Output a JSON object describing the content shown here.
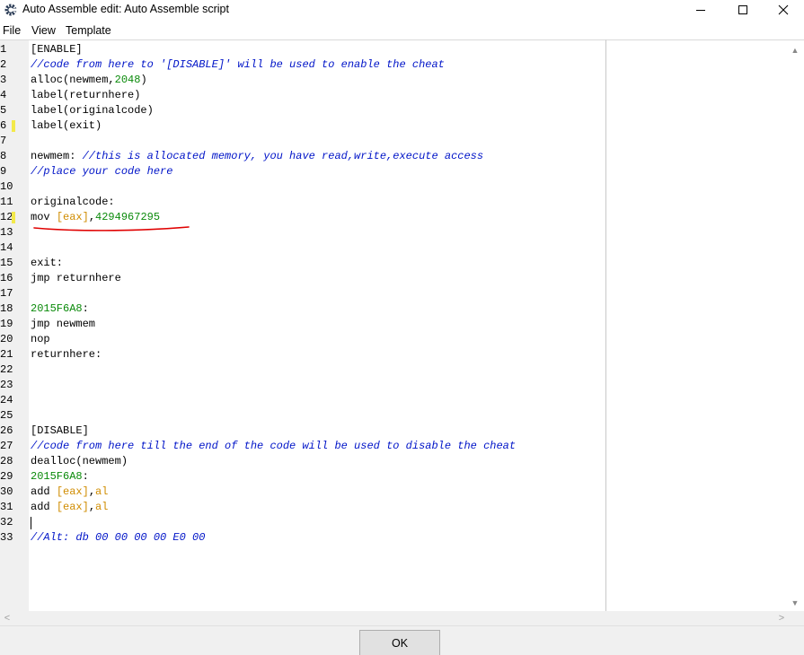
{
  "window": {
    "title": "Auto Assemble edit: Auto Assemble script",
    "minimize_symbol": "—",
    "maximize_symbol": "☐",
    "close_symbol": "✕",
    "icon": "cheat-engine-gear-icon"
  },
  "menu": {
    "items": [
      {
        "label": "File"
      },
      {
        "label": "View"
      },
      {
        "label": "Template"
      }
    ]
  },
  "colors": {
    "comment": "#0014c8",
    "number": "#0a8a0a",
    "register": "#d08c00",
    "gutter_mark": "#f3e94a",
    "annotation_underline": "#e00000"
  },
  "editor": {
    "marked_lines": [
      6,
      12
    ],
    "caret_line": 32,
    "lines": [
      {
        "n": "1",
        "parts": [
          {
            "t": "[ENABLE]",
            "c": "kw"
          }
        ]
      },
      {
        "n": "2",
        "parts": [
          {
            "t": "//code from here to '[DISABLE]' will be used to enable the cheat",
            "c": "cm"
          }
        ]
      },
      {
        "n": "3",
        "parts": [
          {
            "t": "alloc(newmem,",
            "c": "kw"
          },
          {
            "t": "2048",
            "c": "nm"
          },
          {
            "t": ")",
            "c": "kw"
          }
        ]
      },
      {
        "n": "4",
        "parts": [
          {
            "t": "label(returnhere)",
            "c": "kw"
          }
        ]
      },
      {
        "n": "5",
        "parts": [
          {
            "t": "label(originalcode)",
            "c": "kw"
          }
        ]
      },
      {
        "n": "6",
        "parts": [
          {
            "t": "label(exit)",
            "c": "kw"
          }
        ]
      },
      {
        "n": "7",
        "parts": []
      },
      {
        "n": "8",
        "parts": [
          {
            "t": "newmem: ",
            "c": "kw"
          },
          {
            "t": "//this is allocated memory, you have read,write,execute access",
            "c": "cm"
          }
        ]
      },
      {
        "n": "9",
        "parts": [
          {
            "t": "//place your code here",
            "c": "cm"
          }
        ]
      },
      {
        "n": "10",
        "parts": []
      },
      {
        "n": "11",
        "parts": [
          {
            "t": "originalcode:",
            "c": "kw"
          }
        ]
      },
      {
        "n": "12",
        "parts": [
          {
            "t": "mov ",
            "c": "kw"
          },
          {
            "t": "[eax]",
            "c": "rg"
          },
          {
            "t": ",",
            "c": "kw"
          },
          {
            "t": "4294967295",
            "c": "nm"
          }
        ]
      },
      {
        "n": "13",
        "parts": []
      },
      {
        "n": "14",
        "parts": []
      },
      {
        "n": "15",
        "parts": [
          {
            "t": "exit:",
            "c": "kw"
          }
        ]
      },
      {
        "n": "16",
        "parts": [
          {
            "t": "jmp returnhere",
            "c": "kw"
          }
        ]
      },
      {
        "n": "17",
        "parts": []
      },
      {
        "n": "18",
        "parts": [
          {
            "t": "2015F6A8",
            "c": "nm"
          },
          {
            "t": ":",
            "c": "kw"
          }
        ]
      },
      {
        "n": "19",
        "parts": [
          {
            "t": "jmp newmem",
            "c": "kw"
          }
        ]
      },
      {
        "n": "20",
        "parts": [
          {
            "t": "nop",
            "c": "kw"
          }
        ]
      },
      {
        "n": "21",
        "parts": [
          {
            "t": "returnhere:",
            "c": "kw"
          }
        ]
      },
      {
        "n": "22",
        "parts": []
      },
      {
        "n": "23",
        "parts": []
      },
      {
        "n": "24",
        "parts": []
      },
      {
        "n": "25",
        "parts": []
      },
      {
        "n": "26",
        "parts": [
          {
            "t": "[DISABLE]",
            "c": "kw"
          }
        ]
      },
      {
        "n": "27",
        "parts": [
          {
            "t": "//code from here till the end of the code will be used to disable the cheat",
            "c": "cm"
          }
        ]
      },
      {
        "n": "28",
        "parts": [
          {
            "t": "dealloc(newmem)",
            "c": "kw"
          }
        ]
      },
      {
        "n": "29",
        "parts": [
          {
            "t": "2015F6A8",
            "c": "nm"
          },
          {
            "t": ":",
            "c": "kw"
          }
        ]
      },
      {
        "n": "30",
        "parts": [
          {
            "t": "add ",
            "c": "kw"
          },
          {
            "t": "[eax]",
            "c": "rg"
          },
          {
            "t": ",",
            "c": "kw"
          },
          {
            "t": "al",
            "c": "rg"
          }
        ]
      },
      {
        "n": "31",
        "parts": [
          {
            "t": "add ",
            "c": "kw"
          },
          {
            "t": "[eax]",
            "c": "rg"
          },
          {
            "t": ",",
            "c": "kw"
          },
          {
            "t": "al",
            "c": "rg"
          }
        ]
      },
      {
        "n": "32",
        "parts": []
      },
      {
        "n": "33",
        "parts": [
          {
            "t": "//Alt: db 00 00 00 00 E0 00",
            "c": "cm"
          }
        ]
      }
    ]
  },
  "scrollbars": {
    "up_arrow": "▲",
    "down_arrow": "▼",
    "left_arrow": "<",
    "right_arrow": ">"
  },
  "buttons": {
    "ok_label": "OK"
  }
}
